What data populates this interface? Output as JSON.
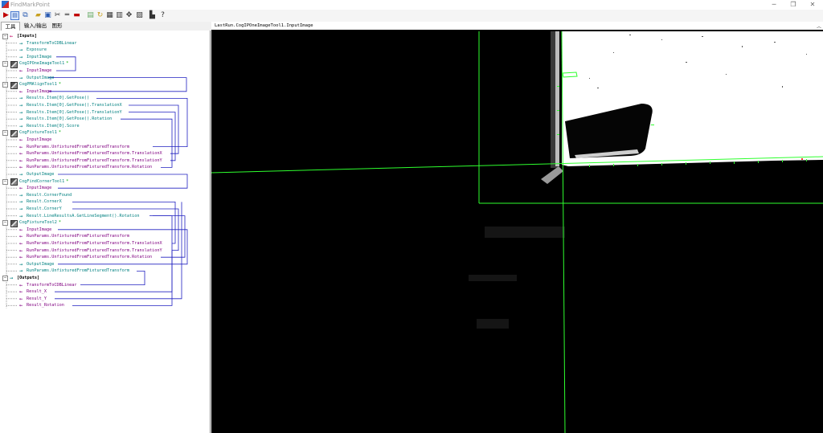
{
  "window": {
    "title": "FindMarkPoint",
    "minimize": "─",
    "restore": "❐",
    "close": "✕"
  },
  "toolbar": {
    "icons": [
      "run-icon",
      "toggle-display-icon",
      "window-icon",
      "open-icon",
      "save-icon",
      "cut-icon",
      "link-icon",
      "delete-icon",
      "properties-icon",
      "refresh-icon",
      "grid-icon",
      "table-icon",
      "tools-icon",
      "image-icon",
      "chart-icon",
      "help-icon"
    ]
  },
  "tabs": [
    "工具",
    "输入/输出",
    "图形"
  ],
  "display": {
    "title": "LastRun.CogIPOneImageTool1.InputImage"
  },
  "tree": [
    {
      "label": "[Inputs]",
      "kind": "header",
      "color": "#000000",
      "arrow": "←",
      "arrow_color": "#c00060"
    },
    {
      "label": "TransformToCDBLinear",
      "color": "#008080",
      "arrow": "→",
      "arrow_color": "#008080"
    },
    {
      "label": "Exposure",
      "color": "#008080",
      "arrow": "→",
      "arrow_color": "#008080"
    },
    {
      "label": "InputImage",
      "color": "#008080",
      "arrow": "→",
      "arrow_color": "#008080"
    },
    {
      "label": "CogIPOneImageTool1",
      "kind": "tool",
      "color": "#008080",
      "star": "*"
    },
    {
      "label": "InputImage",
      "color": "#800080",
      "arrow": "←",
      "arrow_color": "#800080"
    },
    {
      "label": "OutputImage",
      "color": "#008080",
      "arrow": "→",
      "arrow_color": "#008080"
    },
    {
      "label": "CogPMAlignTool1",
      "kind": "tool",
      "color": "#008080",
      "star": "*"
    },
    {
      "label": "InputImage",
      "color": "#800080",
      "arrow": "←",
      "arrow_color": "#800080"
    },
    {
      "label": "Results.Item[0].GetPose()",
      "color": "#008080",
      "arrow": "→",
      "arrow_color": "#008080"
    },
    {
      "label": "Results.Item[0].GetPose().TranslationX",
      "color": "#008080",
      "arrow": "→",
      "arrow_color": "#008080"
    },
    {
      "label": "Results.Item[0].GetPose().TranslationY",
      "color": "#008080",
      "arrow": "→",
      "arrow_color": "#008080"
    },
    {
      "label": "Results.Item[0].GetPose().Rotation",
      "color": "#008080",
      "arrow": "→",
      "arrow_color": "#008080"
    },
    {
      "label": "Results.Item[0].Score",
      "color": "#008080",
      "arrow": "→",
      "arrow_color": "#008080"
    },
    {
      "label": "CogFixtureTool1",
      "kind": "tool",
      "color": "#008080",
      "star": "*"
    },
    {
      "label": "InputImage",
      "color": "#800080",
      "arrow": "←",
      "arrow_color": "#800080"
    },
    {
      "label": "RunParams.UnfixturedFromFixturedTransform",
      "color": "#800080",
      "arrow": "←",
      "arrow_color": "#800080"
    },
    {
      "label": "RunParams.UnfixturedFromFixturedTransform.TranslationX",
      "color": "#800080",
      "arrow": "←",
      "arrow_color": "#800080"
    },
    {
      "label": "RunParams.UnfixturedFromFixturedTransform.TranslationY",
      "color": "#800080",
      "arrow": "←",
      "arrow_color": "#800080"
    },
    {
      "label": "RunParams.UnfixturedFromFixturedTransform.Rotation",
      "color": "#800080",
      "arrow": "←",
      "arrow_color": "#800080"
    },
    {
      "label": "OutputImage",
      "color": "#008080",
      "arrow": "→",
      "arrow_color": "#008080"
    },
    {
      "label": "CogFindCornerTool1",
      "kind": "tool",
      "color": "#008080",
      "star": "*"
    },
    {
      "label": "InputImage",
      "color": "#800080",
      "arrow": "←",
      "arrow_color": "#800080"
    },
    {
      "label": "Result.CornerFound",
      "color": "#008080",
      "arrow": "→",
      "arrow_color": "#008080"
    },
    {
      "label": "Result.CornerX",
      "color": "#008080",
      "arrow": "→",
      "arrow_color": "#008080"
    },
    {
      "label": "Result.CornerY",
      "color": "#008080",
      "arrow": "→",
      "arrow_color": "#008080"
    },
    {
      "label": "Result.LineResultsA.GetLineSegment().Rotation",
      "color": "#008080",
      "arrow": "→",
      "arrow_color": "#008080"
    },
    {
      "label": "CogFixtureTool2",
      "kind": "tool",
      "color": "#008080",
      "star": "*"
    },
    {
      "label": "InputImage",
      "color": "#800080",
      "arrow": "←",
      "arrow_color": "#800080"
    },
    {
      "label": "RunParams.UnfixturedFromFixturedTransform",
      "color": "#800080",
      "arrow": "←",
      "arrow_color": "#800080"
    },
    {
      "label": "RunParams.UnfixturedFromFixturedTransform.TranslationX",
      "color": "#800080",
      "arrow": "←",
      "arrow_color": "#800080"
    },
    {
      "label": "RunParams.UnfixturedFromFixturedTransform.TranslationY",
      "color": "#800080",
      "arrow": "←",
      "arrow_color": "#800080"
    },
    {
      "label": "RunParams.UnfixturedFromFixturedTransform.Rotation",
      "color": "#800080",
      "arrow": "←",
      "arrow_color": "#800080"
    },
    {
      "label": "OutputImage",
      "color": "#008080",
      "arrow": "→",
      "arrow_color": "#008080"
    },
    {
      "label": "RunParams.UnfixturedFromFixturedTransform",
      "color": "#008080",
      "arrow": "→",
      "arrow_color": "#008080"
    },
    {
      "label": "[Outputs]",
      "kind": "header",
      "color": "#000000",
      "arrow": "→",
      "arrow_color": "#008080"
    },
    {
      "label": "TransformToCDBLinear",
      "color": "#800080",
      "arrow": "←",
      "arrow_color": "#800080"
    },
    {
      "label": "Result_X",
      "color": "#800080",
      "arrow": "←",
      "arrow_color": "#800080"
    },
    {
      "label": "Result_Y",
      "color": "#800080",
      "arrow": "←",
      "arrow_color": "#800080"
    },
    {
      "label": "Result_Rotation",
      "color": "#800080",
      "arrow": "←",
      "arrow_color": "#800080"
    }
  ],
  "colors": {
    "link_line": "#2020c0",
    "overlay_green": "#2eff2e",
    "image_bg": "#000000"
  }
}
